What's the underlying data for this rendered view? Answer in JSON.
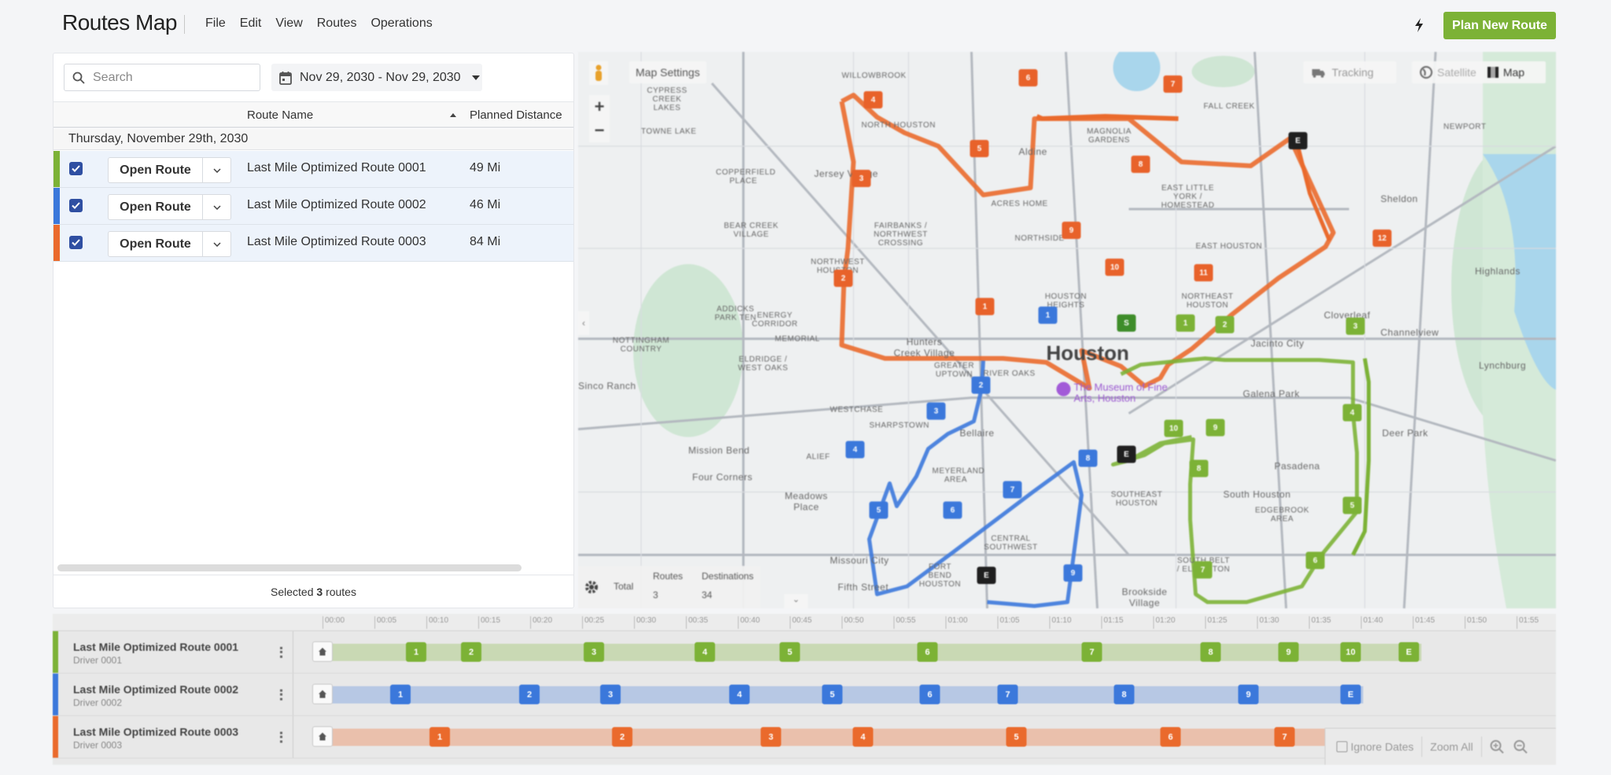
{
  "header": {
    "title": "Routes Map",
    "menu": [
      "File",
      "Edit",
      "View",
      "Routes",
      "Operations"
    ],
    "flash_icon": "lightning-bolt-icon",
    "plan_button": "Plan New Route"
  },
  "colors": {
    "route_1": "#7cb236",
    "route_2": "#3b78db",
    "route_3": "#ea6a2c",
    "accent": "#7cb236",
    "checkbox": "#2f4fa2"
  },
  "list": {
    "search_placeholder": "Search",
    "date_range": "Nov 29, 2030 - Nov 29, 2030",
    "columns": {
      "route_name": "Route Name",
      "planned_distance": "Planned Distance"
    },
    "group_label": "Thursday, November 29th, 2030",
    "open_label": "Open Route",
    "rows": [
      {
        "name": "Last Mile Optimized Route 0001",
        "distance": "49 Mi",
        "checked": true
      },
      {
        "name": "Last Mile Optimized Route 0002",
        "distance": "46 Mi",
        "checked": true
      },
      {
        "name": "Last Mile Optimized Route 0003",
        "distance": "84 Mi",
        "checked": true
      }
    ],
    "selected_prefix": "Selected",
    "selected_count": "3",
    "selected_suffix": "routes"
  },
  "map": {
    "settings_label": "Map Settings",
    "tracking_label": "Tracking",
    "satellite_label": "Satellite",
    "map_label": "Map",
    "city_label": "Houston",
    "poi_label": "The Museum of Fine Arts, Houston",
    "place_labels": [
      "WILLOWBROOK",
      "CYPRESS CREEK LAKES",
      "TOWNE LAKE",
      "NORTH HOUSTON",
      "COPPERFIELD PLACE",
      "Jersey Village",
      "Aldine",
      "MAGNOLIA GARDENS",
      "FALL CREEK",
      "EAST LITTLE YORK / HOMESTEAD",
      "ACRES HOME",
      "BEAR CREEK VILLAGE",
      "FAIRBANKS / NORTHWEST CROSSING",
      "NORTHSIDE",
      "EAST HOUSTON",
      "Sheldon",
      "NEWPORT",
      "Highlands",
      "NORTHWEST HOUSTON",
      "ADDICKS PARK TEN",
      "ENERGY CORRIDOR",
      "MEMORIAL",
      "HOUSTON HEIGHTS",
      "NORTHEAST HOUSTON",
      "Cloverleaf",
      "Channelview",
      "NOTTINGHAM COUNTRY",
      "Hunters Creek Village",
      "GREATER UPTOWN",
      "RIVER OAKS",
      "Jacinto City",
      "Galena Park",
      "ELDRIDGE / WEST OAKS",
      "WESTCHASE",
      "Sinco Ranch",
      "Mission Bend",
      "SHARPSTOWN",
      "Bellaire",
      "Deer Park",
      "Pasadena",
      "ALIEF",
      "Four Corners",
      "MEYERLAND AREA",
      "SOUTHEAST HOUSTON",
      "South Houston",
      "Meadows Place",
      "CENTRAL SOUTHWEST",
      "EDGEBROOK AREA",
      "Missouri City",
      "FORT BEND HOUSTON",
      "Fifth Street",
      "Brookside Village",
      "SOUTH BELT / ELLINGTON",
      "Lynchburg"
    ],
    "totals": {
      "label": "Total",
      "routes_header": "Routes",
      "routes_value": "3",
      "destinations_header": "Destinations",
      "destinations_value": "34"
    }
  },
  "timeline": {
    "ticks": [
      "00:00",
      "00:05",
      "00:10",
      "00:15",
      "00:20",
      "00:25",
      "00:30",
      "00:35",
      "00:40",
      "00:45",
      "00:50",
      "00:55",
      "01:00",
      "01:05",
      "01:10",
      "01:15",
      "01:20",
      "01:25",
      "01:30",
      "01:35",
      "01:40",
      "01:45",
      "01:50",
      "01:55"
    ],
    "rows": [
      {
        "name": "Last Mile Optimized Route 0001",
        "driver": "Driver 0001",
        "stops": [
          "1",
          "2",
          "3",
          "4",
          "5",
          "6",
          "7",
          "8",
          "9",
          "10",
          "E"
        ]
      },
      {
        "name": "Last Mile Optimized Route 0002",
        "driver": "Driver 0002",
        "stops": [
          "1",
          "2",
          "3",
          "4",
          "5",
          "6",
          "7",
          "8",
          "9",
          "E"
        ]
      },
      {
        "name": "Last Mile Optimized Route 0003",
        "driver": "Driver 0003",
        "stops": [
          "1",
          "2",
          "3",
          "4",
          "5",
          "6",
          "7"
        ]
      }
    ],
    "ignore_dates_label": "Ignore Dates",
    "zoom_all_label": "Zoom All"
  }
}
